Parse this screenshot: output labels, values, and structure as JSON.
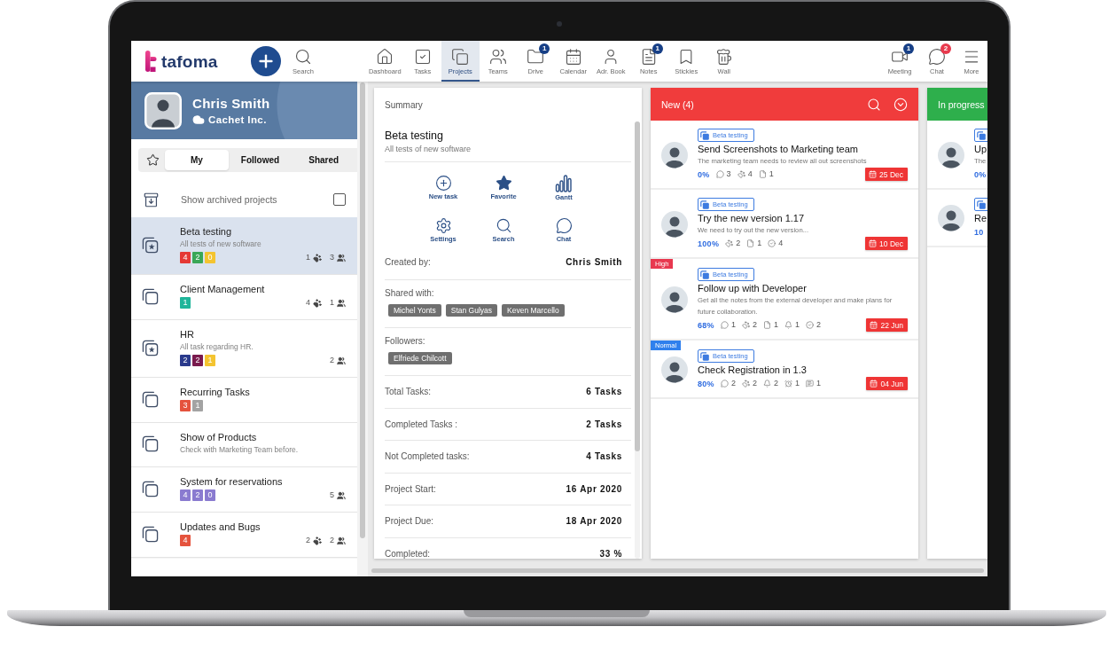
{
  "topbar": {
    "logo": "tafoma",
    "search": {
      "label": "Search"
    },
    "items": [
      {
        "kind": "home",
        "label": "Dashboard",
        "selected": false
      },
      {
        "kind": "tasks",
        "label": "Tasks",
        "selected": false
      },
      {
        "kind": "projects",
        "label": "Projects",
        "selected": true
      },
      {
        "kind": "teams",
        "label": "Teams",
        "selected": false
      },
      {
        "kind": "drive",
        "label": "Drive",
        "selected": false,
        "badge": {
          "text": "1",
          "color": "#173f86"
        }
      },
      {
        "kind": "calendar",
        "label": "Calendar",
        "selected": false
      },
      {
        "kind": "contacts",
        "label": "Adr. Book",
        "selected": false
      },
      {
        "kind": "notes",
        "label": "Notes",
        "selected": false,
        "badge": {
          "text": "1",
          "color": "#173f86"
        }
      },
      {
        "kind": "stickies",
        "label": "Stickies",
        "selected": false
      },
      {
        "kind": "wall",
        "label": "Wall",
        "selected": false
      }
    ],
    "right_items": [
      {
        "kind": "meeting",
        "label": "Meeting",
        "selected": false,
        "badge": {
          "text": "1",
          "color": "#173f86"
        }
      },
      {
        "kind": "chat",
        "label": "Chat",
        "selected": false,
        "badge": {
          "text": "2",
          "color": "#e8394d"
        }
      },
      {
        "kind": "menu",
        "label": "More",
        "selected": false
      }
    ]
  },
  "sidebar": {
    "profile": {
      "name": "Chris Smith",
      "company": "Cachet Inc."
    },
    "tabs": [
      {
        "label": "My",
        "selected": true
      },
      {
        "label": "Followed",
        "selected": false
      },
      {
        "label": "Shared",
        "selected": false
      }
    ],
    "archived": {
      "label": "Show archived projects",
      "checked": false
    },
    "projects": [
      {
        "name": "Beta testing",
        "description": "All tests of new software",
        "starred": true,
        "selected": true,
        "badges": [
          {
            "text": "4",
            "color": "#e53935"
          },
          {
            "text": "2",
            "color": "#3aa757"
          },
          {
            "text": "0",
            "color": "#f4c430"
          }
        ],
        "stats": [
          {
            "kind": "paw",
            "count": "1"
          },
          {
            "kind": "people",
            "count": "3"
          }
        ]
      },
      {
        "name": "Client Management",
        "starred": false,
        "selected": false,
        "badges": [
          {
            "text": "1",
            "color": "#1fb59a"
          }
        ],
        "stats": [
          {
            "kind": "paw",
            "count": "4"
          },
          {
            "kind": "people",
            "count": "1"
          }
        ]
      },
      {
        "name": "HR",
        "description": "All task regarding HR.",
        "starred": true,
        "selected": false,
        "badges": [
          {
            "text": "2",
            "color": "#2a3a8c"
          },
          {
            "text": "2",
            "color": "#7a1a4e"
          },
          {
            "text": "1",
            "color": "#f4c430"
          }
        ],
        "stats": [
          {
            "kind": "people",
            "count": "2"
          }
        ]
      },
      {
        "name": "Recurring Tasks",
        "starred": false,
        "selected": false,
        "badges": [
          {
            "text": "3",
            "color": "#e5533d"
          },
          {
            "text": "1",
            "color": "#a3a3a3"
          }
        ]
      },
      {
        "name": "Show of Products",
        "description": "Check with Marketing Team before.",
        "starred": false,
        "selected": false
      },
      {
        "name": "System for reservations",
        "starred": false,
        "selected": false,
        "badges": [
          {
            "text": "4",
            "color": "#8a7bd0"
          },
          {
            "text": "2",
            "color": "#8a7bd0"
          },
          {
            "text": "0",
            "color": "#8a7bd0"
          }
        ],
        "stats": [
          {
            "kind": "people",
            "count": "5"
          }
        ]
      },
      {
        "name": "Updates and Bugs",
        "starred": false,
        "selected": false,
        "badges": [
          {
            "text": "4",
            "color": "#e5533d"
          }
        ],
        "stats": [
          {
            "kind": "paw",
            "count": "2"
          },
          {
            "kind": "people",
            "count": "2"
          }
        ]
      }
    ]
  },
  "summary": {
    "title": "Summary",
    "project": {
      "name": "Beta testing",
      "description": "All tests of new software"
    },
    "actions": [
      {
        "kind": "new_task",
        "label": "New task"
      },
      {
        "kind": "favorite",
        "label": "Favorite"
      },
      {
        "kind": "gantt",
        "label": "Gantt"
      },
      {
        "kind": "settings",
        "label": "Settings"
      },
      {
        "kind": "search",
        "label": "Search"
      },
      {
        "kind": "chat",
        "label": "Chat"
      }
    ],
    "created_by": {
      "label": "Created by:",
      "value": "Chris Smith"
    },
    "shared_with": {
      "label": "Shared with:",
      "people": [
        "Michel Yonts",
        "Stan Gulyas",
        "Keven Marcello"
      ]
    },
    "followers": {
      "label": "Followers:",
      "people": [
        "Elfriede Chilcott"
      ]
    },
    "facts": [
      {
        "label": "Total Tasks:",
        "value": "6 Tasks"
      },
      {
        "label": "Completed Tasks :",
        "value": "2 Tasks"
      },
      {
        "label": "Not Completed tasks:",
        "value": "4 Tasks"
      },
      {
        "label": "Project Start:",
        "value": "16 Apr 2020"
      },
      {
        "label": "Project Due:",
        "value": "18 Apr 2020"
      },
      {
        "label": "Completed:",
        "value": "33 %"
      }
    ]
  },
  "board": {
    "columns": [
      {
        "title": "New (4)",
        "color": "#f03c3c",
        "tools": true,
        "cards": [
          {
            "tag": "Beta testing",
            "title": "Send Screenshots to Marketing team",
            "description": "The marketing team needs to review all out screenshots",
            "progress": "0%",
            "stats": [
              {
                "kind": "comment",
                "count": "3"
              },
              {
                "kind": "paw",
                "count": "4"
              },
              {
                "kind": "file",
                "count": "1"
              }
            ],
            "due": "25 Dec"
          },
          {
            "tag": "Beta testing",
            "title": "Try the new version 1.17",
            "description": "We need to try out the new version...",
            "progress": "100%",
            "stats": [
              {
                "kind": "paw",
                "count": "2"
              },
              {
                "kind": "file",
                "count": "1"
              },
              {
                "kind": "check",
                "count": "4"
              }
            ],
            "due": "10 Dec"
          },
          {
            "priority": {
              "label": "High",
              "color": "#e8384f"
            },
            "tag": "Beta testing",
            "title": "Follow up with Developer",
            "description": "Get all the notes from the external developer and make plans for future collaboration.",
            "progress": "68%",
            "stats": [
              {
                "kind": "comment",
                "count": "1"
              },
              {
                "kind": "paw",
                "count": "2"
              },
              {
                "kind": "file",
                "count": "1"
              },
              {
                "kind": "bell",
                "count": "1"
              },
              {
                "kind": "check",
                "count": "2"
              }
            ],
            "due": "22 Jun"
          },
          {
            "priority": {
              "label": "Normal",
              "color": "#2f80ed"
            },
            "tag": "Beta testing",
            "title": "Check Registration in 1.3",
            "progress": "80%",
            "stats": [
              {
                "kind": "comment",
                "count": "2"
              },
              {
                "kind": "paw",
                "count": "2"
              },
              {
                "kind": "bell",
                "count": "2"
              },
              {
                "kind": "alarm",
                "count": "1"
              },
              {
                "kind": "note",
                "count": "1"
              }
            ],
            "due": "04 Jun"
          }
        ]
      },
      {
        "title": "In progress",
        "color": "#2eaf4c",
        "cards": [
          {
            "title": "Up",
            "description": "The",
            "progress": "0%"
          },
          {
            "title": "Re",
            "progress": "10"
          }
        ]
      }
    ]
  }
}
